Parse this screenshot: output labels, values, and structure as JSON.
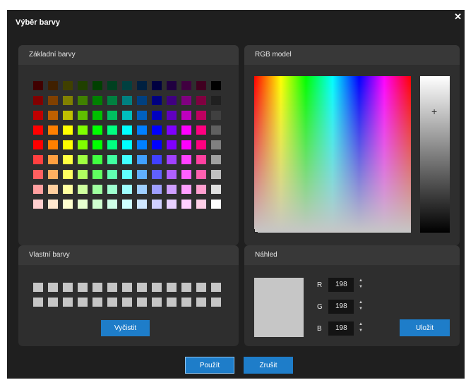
{
  "dialog": {
    "title": "Výběr barvy",
    "close_glyph": "✕"
  },
  "basic": {
    "label": "Základní barvy",
    "colors": [
      [
        "#400000",
        "#402000",
        "#404000",
        "#204000",
        "#004000",
        "#004020",
        "#004040",
        "#002040",
        "#000040",
        "#200040",
        "#400040",
        "#400020",
        "#000000"
      ],
      [
        "#800000",
        "#804000",
        "#808000",
        "#408000",
        "#008000",
        "#008040",
        "#008080",
        "#004080",
        "#000080",
        "#400080",
        "#800080",
        "#800040",
        "#202020"
      ],
      [
        "#bf0000",
        "#bf6000",
        "#bfbf00",
        "#60bf00",
        "#00bf00",
        "#00bf60",
        "#00bfbf",
        "#0060bf",
        "#0000bf",
        "#6000bf",
        "#bf00bf",
        "#bf0060",
        "#404040"
      ],
      [
        "#ff0000",
        "#ff8000",
        "#ffff00",
        "#80ff00",
        "#00ff00",
        "#00ff80",
        "#00ffff",
        "#0080ff",
        "#0000ff",
        "#8000ff",
        "#ff00ff",
        "#ff0080",
        "#606060"
      ],
      [
        "#ff0000",
        "#ff8000",
        "#ffff00",
        "#80ff00",
        "#00ff00",
        "#00ff80",
        "#00ffff",
        "#0080ff",
        "#0000ff",
        "#8000ff",
        "#ff00ff",
        "#ff0080",
        "#808080"
      ],
      [
        "#ff4040",
        "#ffa040",
        "#ffff40",
        "#a0ff40",
        "#40ff40",
        "#40ffa0",
        "#40ffff",
        "#40a0ff",
        "#4040ff",
        "#a040ff",
        "#ff40ff",
        "#ff40a0",
        "#a0a0a0"
      ],
      [
        "#ff6060",
        "#ffb060",
        "#ffff60",
        "#b0ff60",
        "#60ff60",
        "#60ffb0",
        "#60ffff",
        "#60b0ff",
        "#6060ff",
        "#b060ff",
        "#ff60ff",
        "#ff60b0",
        "#c0c0c0"
      ],
      [
        "#ff9f9f",
        "#ffcf9f",
        "#ffff9f",
        "#cfff9f",
        "#9fff9f",
        "#9fffcf",
        "#9fffff",
        "#9fcfff",
        "#9f9fff",
        "#cf9fff",
        "#ff9fff",
        "#ff9fcf",
        "#e0e0e0"
      ],
      [
        "#ffcfcf",
        "#ffe7cf",
        "#ffffcf",
        "#e7ffcf",
        "#cfffcf",
        "#cfffe7",
        "#cfffff",
        "#cfe7ff",
        "#cfcfff",
        "#e7cfff",
        "#ffcfff",
        "#ffcfe7",
        "#ffffff"
      ]
    ]
  },
  "custom": {
    "label": "Vlastní barvy",
    "swatch_color": "#c6c6c6",
    "clear_label": "Vyčistit"
  },
  "rgb": {
    "label": "RGB model",
    "crosshair_glyph": "+"
  },
  "preview": {
    "label": "Náhled",
    "color": "#c6c6c6",
    "r_label": "R",
    "r_value": "198",
    "g_label": "G",
    "g_value": "198",
    "b_label": "B",
    "b_value": "198",
    "save_label": "Uložit"
  },
  "footer": {
    "apply_label": "Použít",
    "cancel_label": "Zrušit"
  },
  "colors": {
    "accent": "#1e7dc9",
    "panel": "#2e2e2e",
    "header": "#383838",
    "background": "#1f1f1f"
  }
}
